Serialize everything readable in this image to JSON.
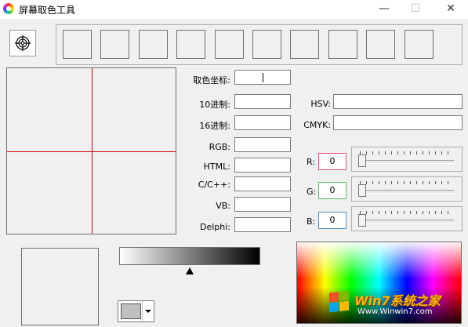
{
  "window": {
    "title": "屏幕取色工具",
    "minimize_glyph": "—",
    "maximize_glyph": "☐",
    "close_glyph": "✕"
  },
  "fields": {
    "coord": {
      "label": "取色坐标:",
      "value": ""
    },
    "dec": {
      "label": "10进制:",
      "value": ""
    },
    "hex": {
      "label": "16进制:",
      "value": ""
    },
    "rgb": {
      "label": "RGB:",
      "value": ""
    },
    "html": {
      "label": "HTML:",
      "value": ""
    },
    "cpp": {
      "label": "C/C++:",
      "value": ""
    },
    "vb": {
      "label": "VB:",
      "value": ""
    },
    "delphi": {
      "label": "Delphi:",
      "value": ""
    },
    "hsv": {
      "label": "HSV:",
      "value": ""
    },
    "cmyk": {
      "label": "CMYK:",
      "value": ""
    }
  },
  "channels": {
    "r": {
      "label": "R:",
      "value": "0",
      "color": "#d9536a"
    },
    "g": {
      "label": "G:",
      "value": "0",
      "color": "#5cb85c"
    },
    "b": {
      "label": "B:",
      "value": "0",
      "color": "#4f8fc9"
    }
  },
  "swatches": [
    "#f0f0f0",
    "#f0f0f0",
    "#f0f0f0",
    "#f0f0f0",
    "#f0f0f0",
    "#f0f0f0",
    "#f0f0f0",
    "#f0f0f0",
    "#f0f0f0",
    "#f0f0f0"
  ],
  "gray_slider_level": 0.5,
  "combo_color": "#c0c0c0",
  "icons": {
    "picker": "crosshair-target-icon",
    "app": "color-wheel-icon"
  },
  "watermark": {
    "brand": "Win7系统之家",
    "url": "Www.Winwin7.com"
  }
}
